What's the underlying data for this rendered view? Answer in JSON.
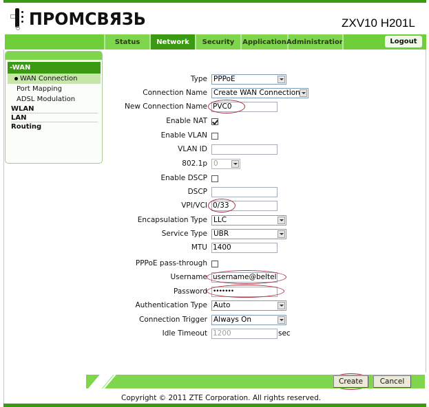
{
  "brand": {
    "logo_text": "ПРОМСВЯЗЬ",
    "model": "ZXV10 H201L"
  },
  "nav": {
    "tabs": [
      {
        "label": "Status",
        "active": false
      },
      {
        "label": "Network",
        "active": true
      },
      {
        "label": "Security",
        "active": false
      },
      {
        "label": "Application",
        "active": false
      },
      {
        "label": "Administration",
        "active": false
      }
    ],
    "logout_label": "Logout"
  },
  "sidebar": {
    "section": "-WAN",
    "items": [
      {
        "label": "WAN Connection",
        "active": true
      },
      {
        "label": "Port Mapping",
        "active": false
      },
      {
        "label": "ADSL Modulation",
        "active": false
      }
    ],
    "groups": [
      "WLAN",
      "LAN",
      "Routing"
    ]
  },
  "form": {
    "type": {
      "label": "Type",
      "value": "PPPoE"
    },
    "connection_name": {
      "label": "Connection Name",
      "value": "Create WAN Connection"
    },
    "new_connection_name": {
      "label": "New Connection Name",
      "value": "PVC0"
    },
    "enable_nat": {
      "label": "Enable NAT",
      "checked": true
    },
    "enable_vlan": {
      "label": "Enable VLAN",
      "checked": false
    },
    "vlan_id": {
      "label": "VLAN ID",
      "value": ""
    },
    "dot1p": {
      "label": "802.1p",
      "value": "0",
      "disabled": true
    },
    "enable_dscp": {
      "label": "Enable DSCP",
      "checked": false
    },
    "dscp": {
      "label": "DSCP",
      "value": ""
    },
    "vpi_vci": {
      "label": "VPI/VCI",
      "value": "0/33"
    },
    "encapsulation_type": {
      "label": "Encapsulation Type",
      "value": "LLC"
    },
    "service_type": {
      "label": "Service Type",
      "value": "UBR"
    },
    "mtu": {
      "label": "MTU",
      "value": "1400"
    },
    "pppoe_passthrough": {
      "label": "PPPoE pass-through",
      "checked": false
    },
    "username": {
      "label": "Username",
      "value": "username@beltel.b"
    },
    "password": {
      "label": "Password",
      "value": "•••••••"
    },
    "authentication_type": {
      "label": "Authentication Type",
      "value": "Auto"
    },
    "connection_trigger": {
      "label": "Connection Trigger",
      "value": "Always On"
    },
    "idle_timeout": {
      "label": "Idle Timeout",
      "value": "1200",
      "unit": "sec",
      "disabled": true
    }
  },
  "actions": {
    "create_label": "Create",
    "cancel_label": "Cancel"
  },
  "footer": {
    "copyright": "Copyright © 2011 ZTE Corporation. All rights reserved."
  },
  "colors": {
    "brand_green": "#7fd64d",
    "active_green": "#3a9a12",
    "annotation_red": "#b03040"
  }
}
